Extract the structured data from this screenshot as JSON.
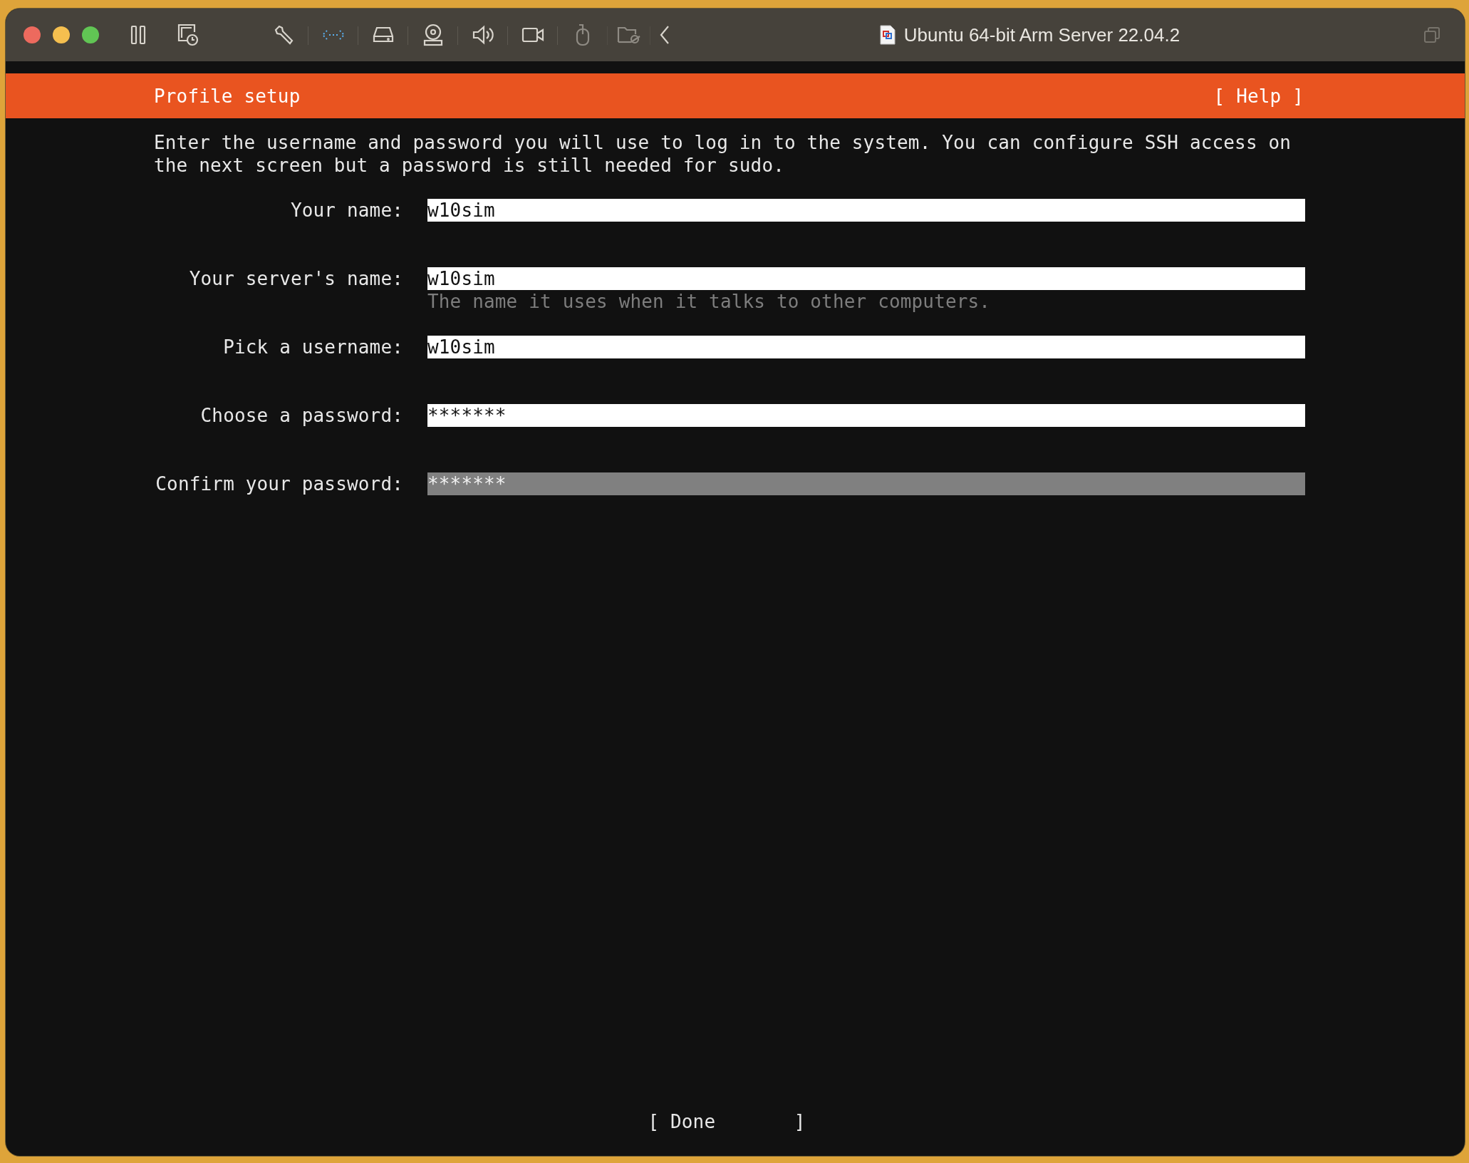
{
  "window": {
    "title": "Ubuntu 64-bit Arm Server 22.04.2"
  },
  "toolbar": [
    {
      "kind": "pause",
      "active": false,
      "disabled": false
    },
    {
      "kind": "snapshot",
      "active": false,
      "disabled": false
    },
    {
      "kind": "wrench",
      "active": false,
      "disabled": false
    },
    {
      "kind": "network",
      "active": true,
      "disabled": false
    },
    {
      "kind": "disk",
      "active": false,
      "disabled": false
    },
    {
      "kind": "webcam",
      "active": false,
      "disabled": false
    },
    {
      "kind": "speaker",
      "active": false,
      "disabled": false
    },
    {
      "kind": "video",
      "active": false,
      "disabled": false
    },
    {
      "kind": "mouse",
      "active": false,
      "disabled": true
    },
    {
      "kind": "folder",
      "active": false,
      "disabled": true
    },
    {
      "kind": "chevron",
      "active": false,
      "disabled": false
    }
  ],
  "header": {
    "title": "Profile setup",
    "help": "[ Help ]"
  },
  "intro": "Enter the username and password you will use to log in to the system. You can configure SSH access on the next screen but a password is still needed for sudo.",
  "fields": [
    {
      "label": "Your name:",
      "value": "w10sim",
      "focused": false
    },
    {
      "label": "Your server's name:",
      "value": "w10sim",
      "hint": "The name it uses when it talks to other computers.",
      "focused": false
    },
    {
      "label": "Pick a username:",
      "value": "w10sim",
      "focused": false
    },
    {
      "label": "Choose a password:",
      "value": "*******",
      "focused": false
    },
    {
      "label": "Confirm your password:",
      "value": "*******",
      "focused": true
    }
  ],
  "done_button": "[ Done       ]"
}
